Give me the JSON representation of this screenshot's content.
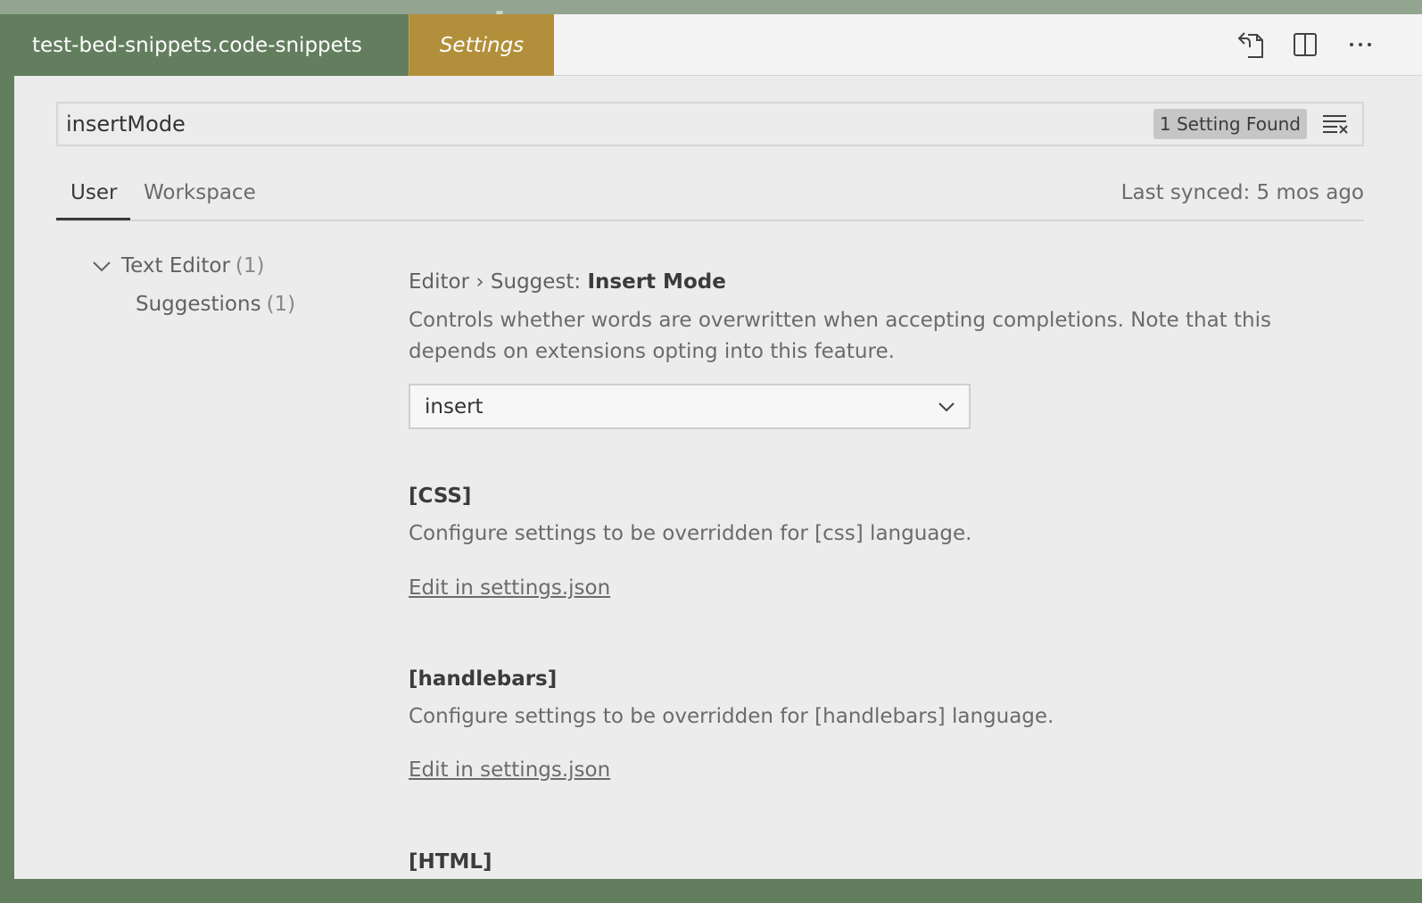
{
  "tabs": {
    "file_tab": "test-bed-snippets.code-snippets",
    "settings_tab": "Settings"
  },
  "search": {
    "value": "insertMode",
    "results_badge": "1 Setting Found"
  },
  "scope_tabs": {
    "user": "User",
    "workspace": "Workspace",
    "last_synced": "Last synced: 5 mos ago"
  },
  "toc": {
    "text_editor": {
      "label": "Text Editor",
      "count": "(1)"
    },
    "suggestions": {
      "label": "Suggestions",
      "count": "(1)"
    }
  },
  "setting": {
    "category": "Editor › Suggest: ",
    "name": "Insert Mode",
    "description_line1": "Controls whether words are overwritten when accepting completions. Note that this",
    "description_line2": "depends on extensions opting into this feature.",
    "selected_value": "insert"
  },
  "overrides": [
    {
      "title": "[CSS]",
      "description": "Configure settings to be overridden for [css] language.",
      "link": "Edit in settings.json"
    },
    {
      "title": "[handlebars]",
      "description": "Configure settings to be overridden for [handlebars] language.",
      "link": "Edit in settings.json"
    },
    {
      "title": "[HTML]"
    }
  ],
  "icons": {
    "open_json": "open-settings-json-icon",
    "split": "split-editor-icon",
    "more": "more-actions-icon",
    "clear": "clear-search-icon"
  }
}
